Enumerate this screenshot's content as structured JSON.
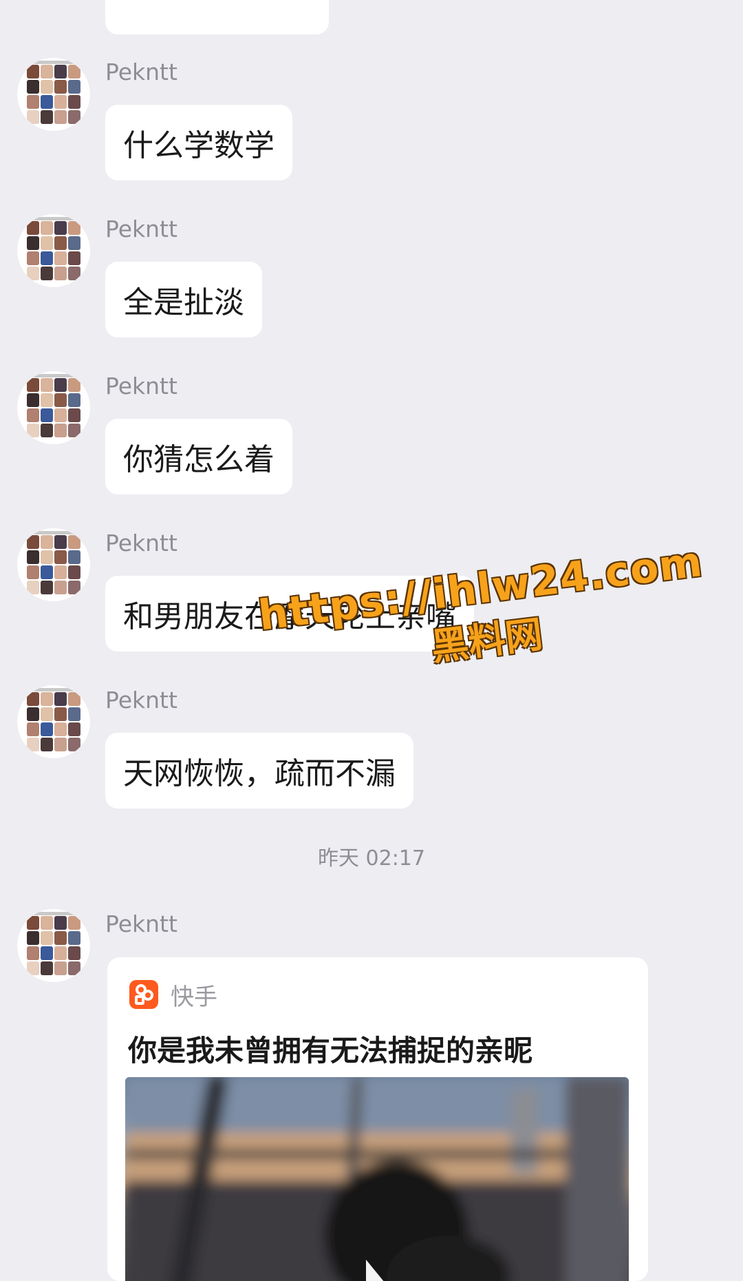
{
  "colors": {
    "background": "#ededf2",
    "bubble": "#ffffff",
    "sender_name": "#8d8d94",
    "kuaishou_brand": "#fe5a1e",
    "watermark": "#f7a21b"
  },
  "messages": [
    {
      "sender": "Pekntt",
      "text": "什么学数学"
    },
    {
      "sender": "Pekntt",
      "text": "全是扯淡"
    },
    {
      "sender": "Pekntt",
      "text": "你猜怎么着"
    },
    {
      "sender": "Pekntt",
      "text": "和男朋友在摩天轮上亲嘴"
    },
    {
      "sender": "Pekntt",
      "text": "天网恢恢，疏而不漏"
    }
  ],
  "timestamp": "昨天 02:17",
  "share_card": {
    "sender": "Pekntt",
    "app_name": "快手",
    "app_icon": "kuaishou-logo-icon",
    "title": "你是我未曾拥有无法捕捉的亲昵"
  },
  "watermark": {
    "url": "https://ihlw24.com",
    "subtitle": "黑料网"
  }
}
